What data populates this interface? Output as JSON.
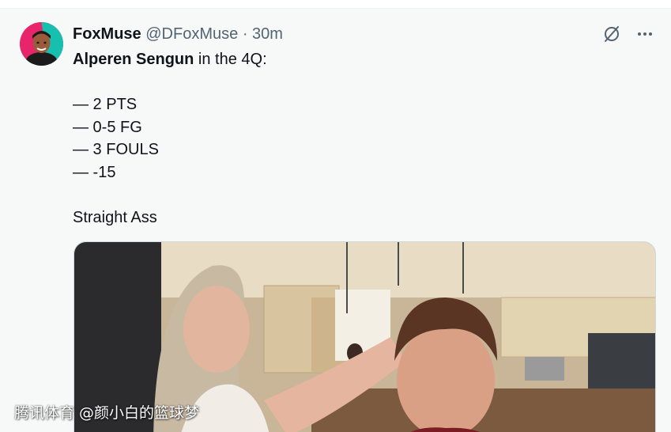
{
  "tweet": {
    "author_name": "FoxMuse",
    "author_handle": "@DFoxMuse",
    "separator": "·",
    "time": "30m",
    "text": {
      "player": "Alperen Sengun",
      "intro_rest": " in the 4Q:",
      "stats": [
        "— 2 PTS",
        "— 0-5 FG",
        "— 3 FOULS",
        "— -15"
      ],
      "closing": "Straight Ass"
    }
  },
  "icons": {
    "grok": "grok-slash-icon",
    "more": "more-dots-icon"
  },
  "watermark": "腾讯体育 @颜小白的篮球梦",
  "colors": {
    "text": "#0f1419",
    "secondary": "#536471",
    "background": "#f7f9f9"
  }
}
